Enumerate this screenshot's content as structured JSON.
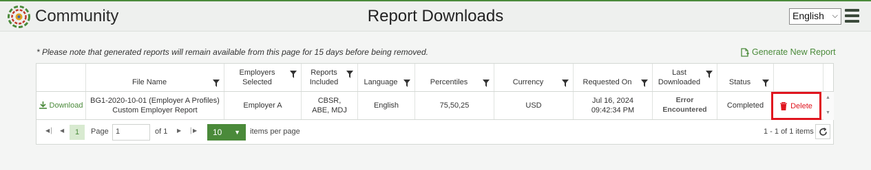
{
  "header": {
    "brand": "Community",
    "title": "Report Downloads",
    "language": "English"
  },
  "note": "* Please note that generated reports will remain available from this page for 15 days before being removed.",
  "generate_label": "Generate New Report",
  "columns": {
    "file_name": "File Name",
    "employers": "Employers Selected",
    "reports": "Reports Included",
    "language": "Language",
    "percentiles": "Percentiles",
    "currency": "Currency",
    "requested": "Requested On",
    "last_downloaded": "Last Downloaded",
    "status": "Status"
  },
  "row": {
    "download_label": "Download",
    "file_name": "BG1-2020-10-01 (Employer A Profiles) Custom Employer Report",
    "employers": "Employer A",
    "reports": "CBSR, ABE, MDJ",
    "language": "English",
    "percentiles": "75,50,25",
    "currency": "USD",
    "requested": "Jul 16, 2024 09:42:34 PM",
    "last_downloaded": "Error Encountered",
    "status": "Completed",
    "delete_label": "Delete"
  },
  "pager": {
    "current_page": "1",
    "page_label": "Page",
    "page_value": "1",
    "of_label": "of 1",
    "page_size": "10",
    "items_label": "items per page",
    "summary": "1 - 1 of 1 items"
  },
  "colors": {
    "accent": "#4a8a3a",
    "delete": "#e0141e"
  }
}
